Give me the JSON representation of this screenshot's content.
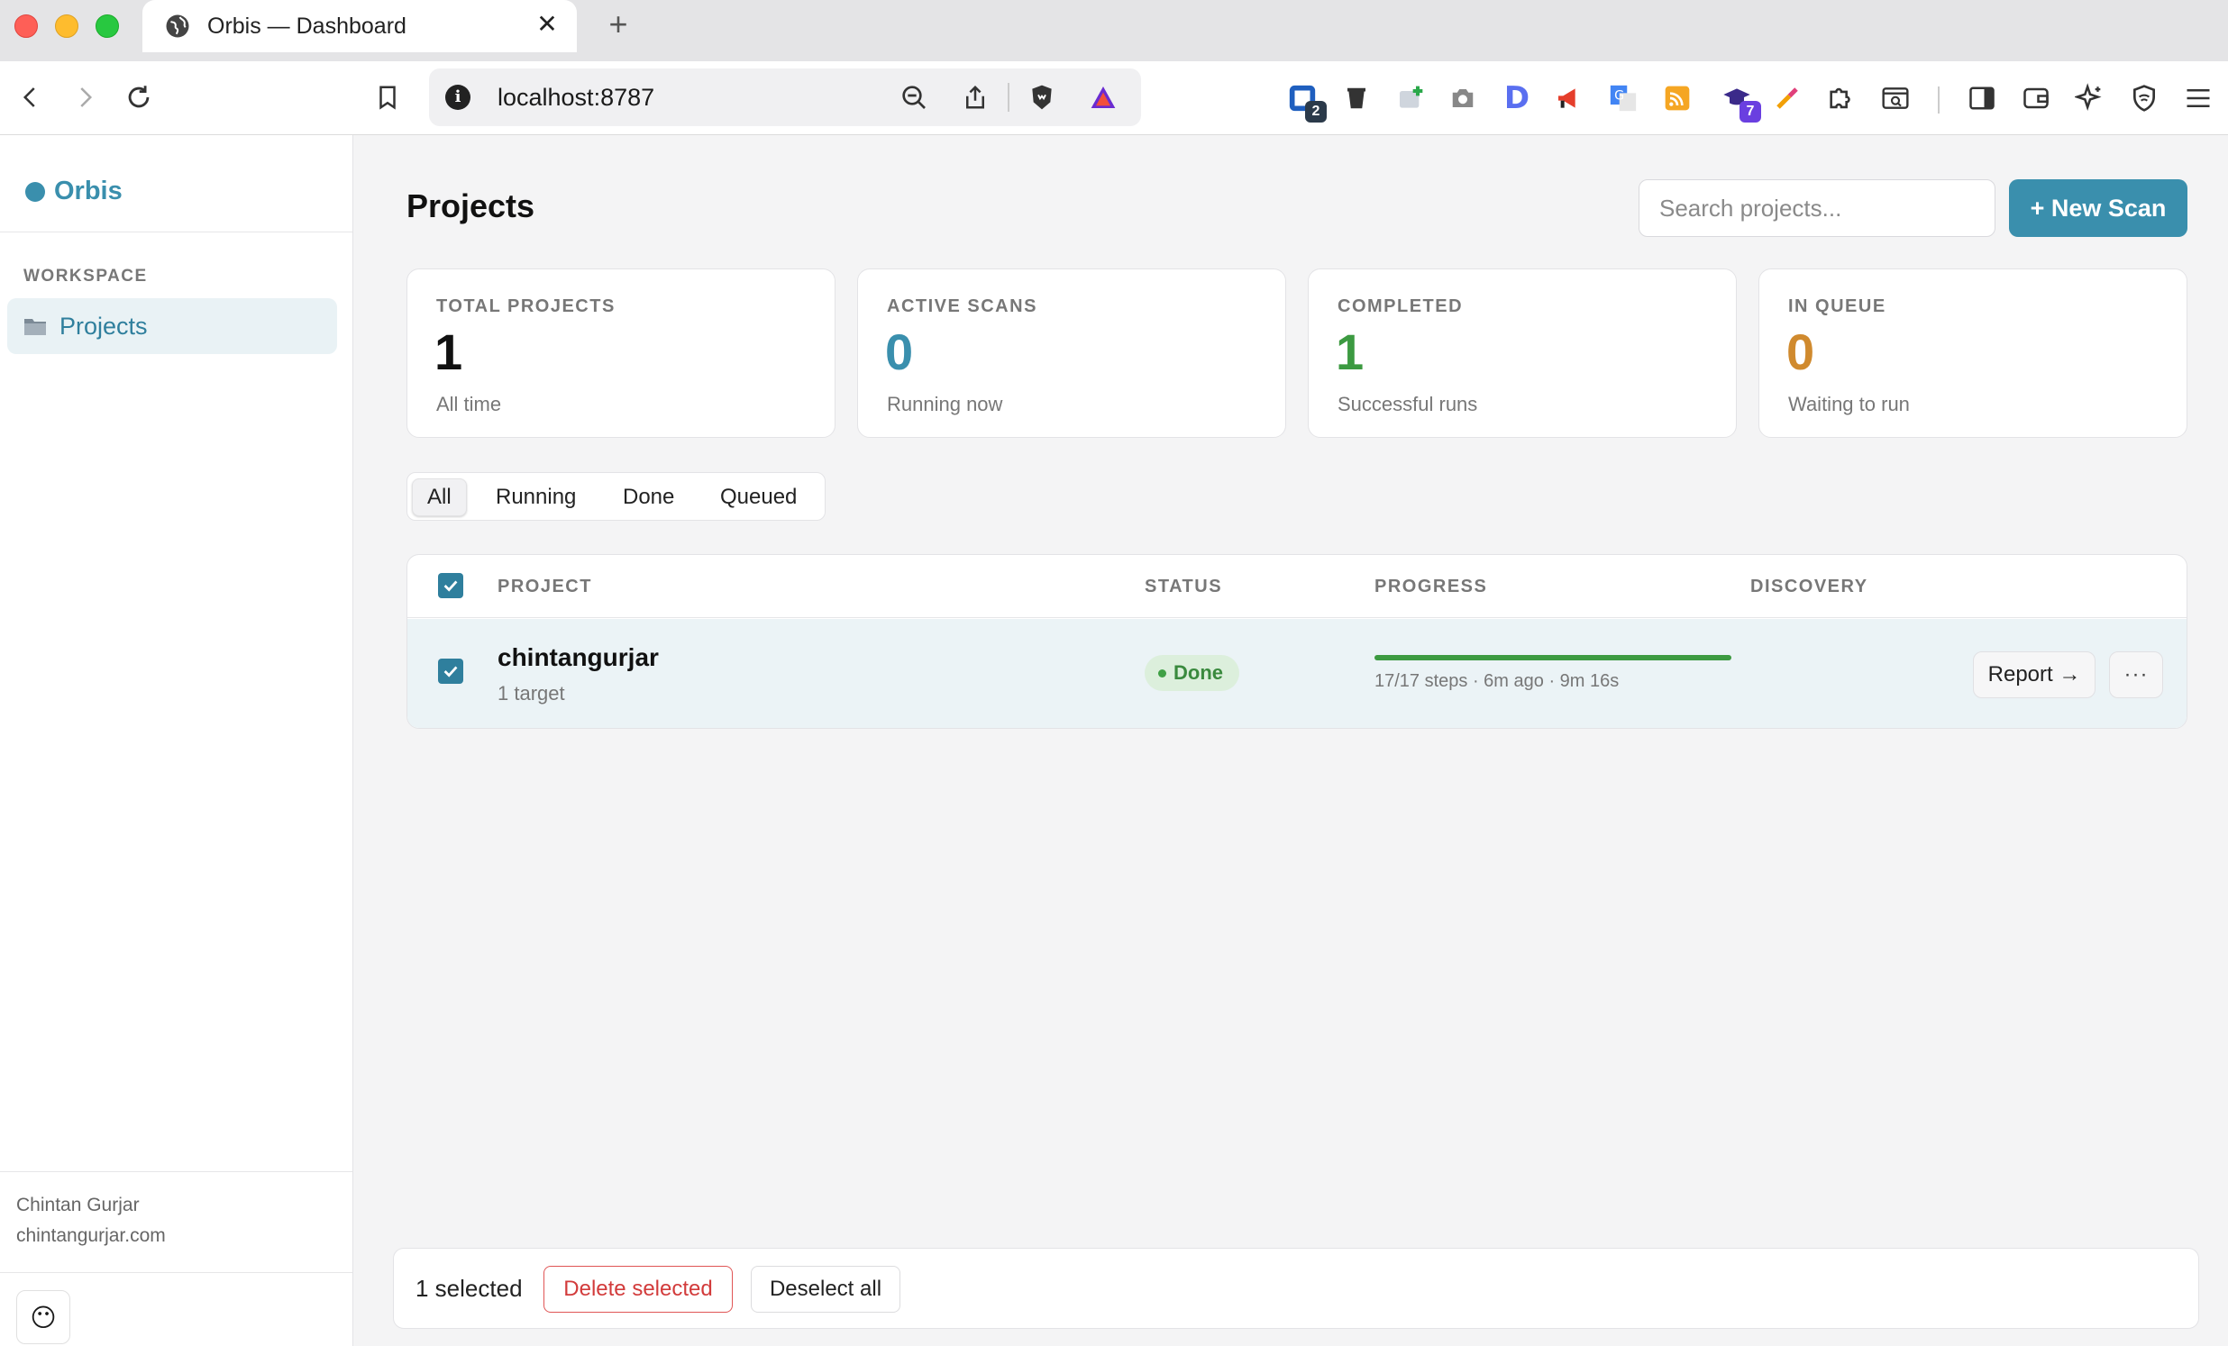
{
  "browser": {
    "tab_title": "Orbis — Dashboard",
    "tab_close": "✕",
    "new_tab": "+",
    "url": "localhost:8787",
    "extension_badges": {
      "first": "2",
      "second": "7"
    }
  },
  "sidebar": {
    "brand": "Orbis",
    "section_label": "WORKSPACE",
    "items": [
      {
        "label": "Projects",
        "icon": "folder-icon"
      }
    ],
    "user_name": "Chintan Gurjar",
    "user_site": "chintangurjar.com",
    "emoji": "😶"
  },
  "header": {
    "title": "Projects",
    "search_placeholder": "Search projects...",
    "new_scan_label": "+ New Scan"
  },
  "stats": [
    {
      "label": "TOTAL PROJECTS",
      "value": "1",
      "sub": "All time",
      "color": "#111111"
    },
    {
      "label": "ACTIVE SCANS",
      "value": "0",
      "sub": "Running now",
      "color": "#3a8fad"
    },
    {
      "label": "COMPLETED",
      "value": "1",
      "sub": "Successful runs",
      "color": "#3c9a41"
    },
    {
      "label": "IN QUEUE",
      "value": "0",
      "sub": "Waiting to run",
      "color": "#d08a2e"
    }
  ],
  "filters": [
    {
      "label": "All",
      "active": true
    },
    {
      "label": "Running",
      "active": false
    },
    {
      "label": "Done",
      "active": false
    },
    {
      "label": "Queued",
      "active": false
    }
  ],
  "table": {
    "columns": [
      "PROJECT",
      "STATUS",
      "PROGRESS",
      "DISCOVERY"
    ],
    "rows": [
      {
        "name": "chintangurjar",
        "targets": "1 target",
        "status": "Done",
        "progress_fraction": 1.0,
        "progress_text": "17/17 steps · 6m ago · 9m 16s",
        "discovery": "",
        "report_label": "Report →",
        "more_label": "···"
      }
    ]
  },
  "bulk": {
    "count_text": "1 selected",
    "delete_label": "Delete selected",
    "deselect_label": "Deselect all"
  },
  "colors": {
    "accent": "#3a8fad",
    "success": "#3c9a41",
    "warning": "#d08a2e",
    "danger": "#d23b3b"
  }
}
